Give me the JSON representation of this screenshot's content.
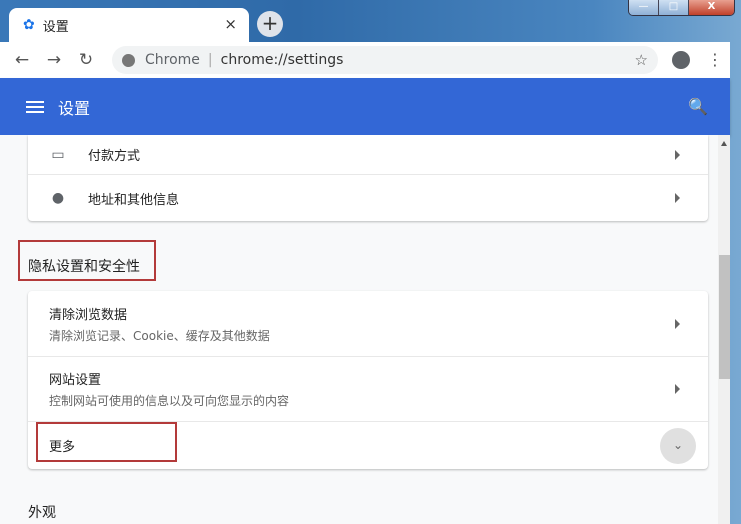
{
  "tab": {
    "title": "设置",
    "icon": "gear-icon",
    "close": "×",
    "new_tab": "+"
  },
  "window": {
    "minimize": "—",
    "maximize": "□",
    "close": "X"
  },
  "toolbar": {
    "back": "←",
    "forward": "→",
    "reload": "↻",
    "host": "Chrome",
    "separator": "|",
    "url": "chrome://settings",
    "bookmark": "☆",
    "menu": "⋮"
  },
  "header": {
    "title": "设置",
    "search": "🔍"
  },
  "autofill": {
    "items": [
      {
        "label": "付款方式",
        "icon": "credit-card-icon"
      },
      {
        "label": "地址和其他信息",
        "icon": "location-pin-icon"
      }
    ]
  },
  "privacy": {
    "title": "隐私设置和安全性",
    "items": [
      {
        "label": "清除浏览数据",
        "sub": "清除浏览记录、Cookie、缓存及其他数据"
      },
      {
        "label": "网站设置",
        "sub": "控制网站可使用的信息以及可向您显示的内容"
      }
    ],
    "more": "更多",
    "more_icon": "⌄"
  },
  "appearance": {
    "title": "外观"
  },
  "colors": {
    "header": "#3367d6",
    "highlight": "#b33a3a"
  }
}
